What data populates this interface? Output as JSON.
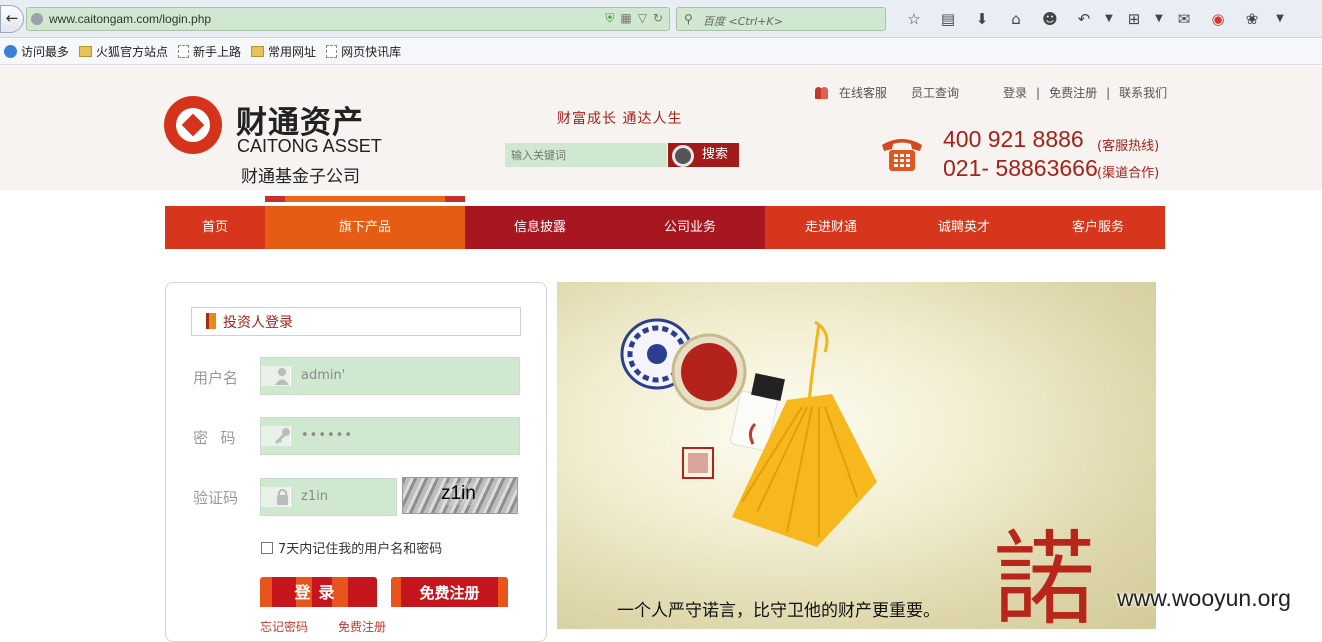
{
  "browser": {
    "url": "www.caitongam.com/login.php",
    "search_placeholder": "百度 <Ctrl+K>",
    "bookmarks": [
      "访问最多",
      "火狐官方站点",
      "新手上路",
      "常用网址",
      "网页快讯库"
    ]
  },
  "header": {
    "logo_cn": "财通资产",
    "logo_en": "CAITONG ASSET",
    "logo_sub": "财通基金子公司",
    "slogan": "财富成长  通达人生",
    "search_placeholder": "输入关键词",
    "search_button": "搜索",
    "top_links": {
      "online_service": "在线客服",
      "staff_query": "员工查询",
      "login": "登录",
      "register": "免费注册",
      "contact": "联系我们"
    },
    "hotline1": "400 921 8886",
    "hotline1_note": "(客服热线)",
    "hotline2": "021- 58863666",
    "hotline2_note": "(渠道合作)"
  },
  "nav": {
    "items": [
      "首页",
      "旗下产品",
      "信息披露",
      "公司业务",
      "走进财通",
      "诚聘英才",
      "客户服务"
    ],
    "active_index": 1,
    "colors": [
      "#d6361c",
      "#e65c13",
      "#a81720",
      "#a81720",
      "#d6361c",
      "#d6361c",
      "#d6361c"
    ]
  },
  "login": {
    "title": "投资人登录",
    "username_label": "用户名",
    "username_value": "admin'",
    "password_label": "密  码",
    "password_value": "••••••",
    "captcha_label": "验证码",
    "captcha_value": "z1in",
    "captcha_image_text": "z1in",
    "remember_label": "7天内记住我的用户名和密码",
    "remember_checked": false,
    "login_button": "登录",
    "register_button": "免费注册",
    "forgot_link": "忘记密码",
    "register_link": "免费注册"
  },
  "banner": {
    "caption": "一个人严守诺言，比守卫他的财产更重要。",
    "char": "諾"
  },
  "watermark": "www.wooyun.org",
  "colors": {
    "brand_red": "#a3231b",
    "field_green": "#cfe8cf"
  }
}
